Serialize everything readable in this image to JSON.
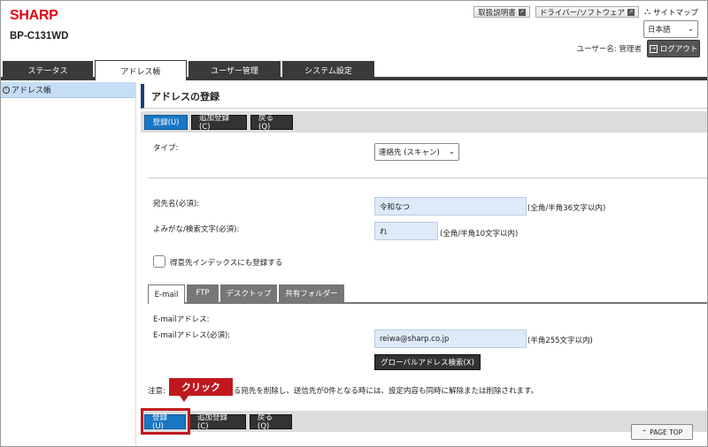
{
  "header": {
    "logo": "SHARP",
    "model": "BP-C131WD",
    "links": [
      "取扱説明書",
      "ドライバー/ソフトウェア"
    ],
    "sitemap": "サイトマップ",
    "language": "日本語",
    "user_label": "ユーザー名: 管理者",
    "logout": "ログアウト"
  },
  "tabs": [
    {
      "label": "ステータス"
    },
    {
      "label": "アドレス帳"
    },
    {
      "label": "ユーザー管理"
    },
    {
      "label": "システム設定"
    }
  ],
  "sidebar": {
    "items": [
      {
        "label": "アドレス帳"
      }
    ]
  },
  "main": {
    "title": "アドレスの登録",
    "buttons": {
      "register": "登録(U)",
      "add_register": "追加登録(C)",
      "back": "戻る(Q)"
    },
    "type_label": "タイプ:",
    "type_value": "連絡先 (スキャン)",
    "name_label": "宛先名(必須):",
    "name_value": "令和なつ",
    "name_hint": "(全角/半角36文字以内)",
    "yomi_label": "よみがな/検索文字(必須):",
    "yomi_value": "れ",
    "yomi_hint": "(全角/半角10文字以内)",
    "favorite_label": "得意先インデックスにも登録する",
    "subtabs": [
      "E-mail",
      "FTP",
      "デスクトップ",
      "共有フォルダー"
    ],
    "email_section_label": "E-mailアドレス:",
    "email_label": "E-mailアドレス(必須):",
    "email_value": "reiwa@sharp.co.jp",
    "email_hint": "(半角255文字以内)",
    "global_search": "グローバルアドレス検索(X)",
    "note_prefix": "注意:",
    "note_suffix": "ている宛先を削除し、送信先が0件となる時には、設定内容も同時に解除または削除されます。",
    "page_top": "PAGE TOP"
  },
  "annotation": {
    "callout": "クリック"
  }
}
